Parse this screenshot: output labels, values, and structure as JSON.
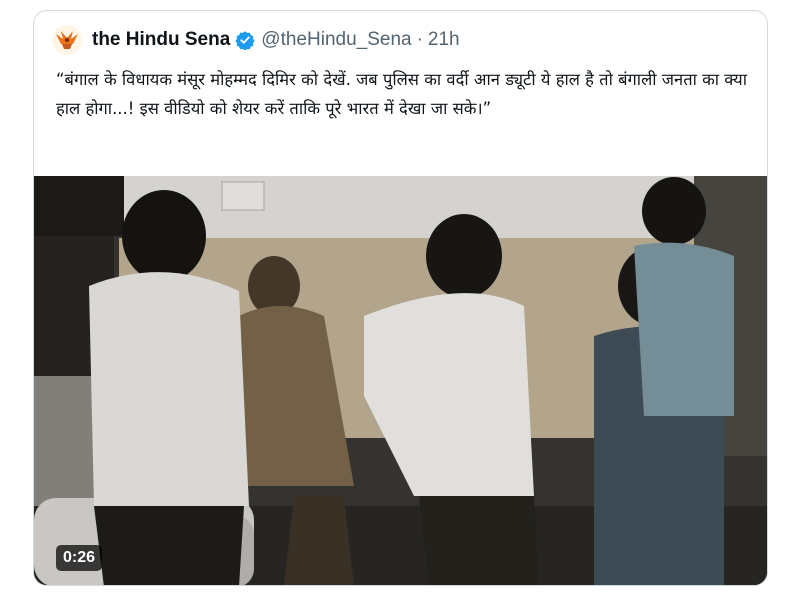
{
  "tweet": {
    "display_name": "the Hindu Sena",
    "handle": "@theHindu_Sena",
    "separator": "·",
    "time": "21h",
    "text": "“बंगाल के विधायक मंसूर मोहम्मद दिमिर को देखें. जब पुलिस का वर्दी आन ड्यूटी ये हाल है तो बंगाली जनता का क्या हाल होगा...! इस वीडियो को शेयर करें ताकि पूरे भारत में देखा जा सके।”",
    "verified_icon": "verified-badge-icon",
    "avatar_icon": "saffron-emblem-icon"
  },
  "media": {
    "type": "video",
    "duration": "0:26"
  },
  "colors": {
    "verified": "#1d9bf0",
    "text": "#0f1419",
    "secondary": "#536471",
    "border": "#cfd9de"
  }
}
